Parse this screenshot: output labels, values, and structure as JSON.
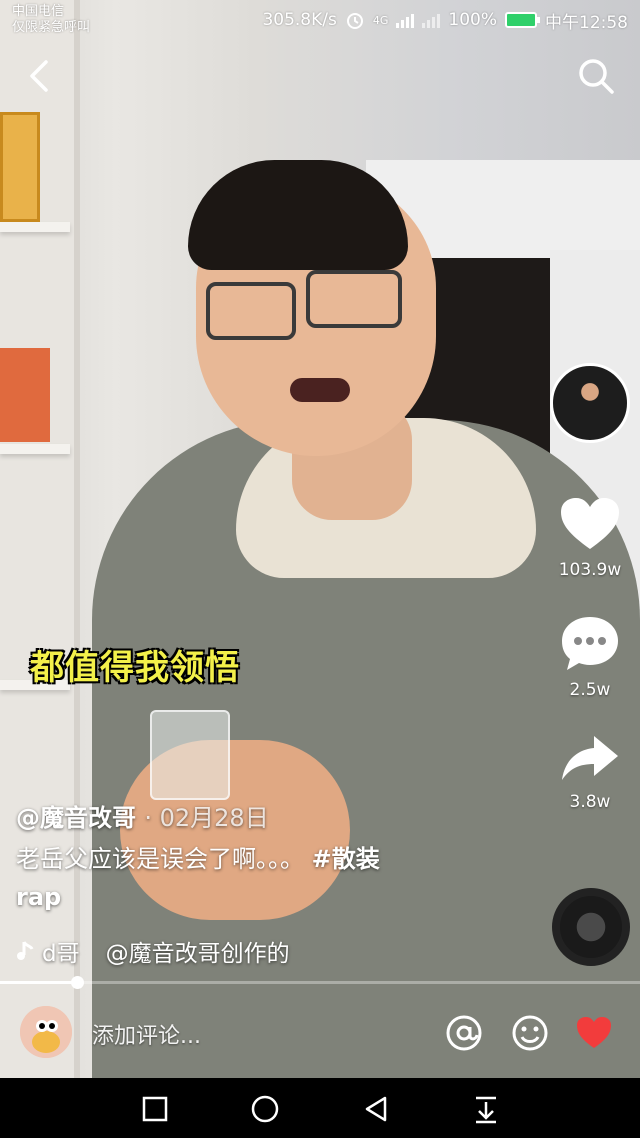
{
  "status_bar": {
    "carrier": "中国电信",
    "carrier_note": "仅限紧急呼叫",
    "speed": "305.8K/s",
    "network": "4G",
    "battery": "100%",
    "time": "中午12:58"
  },
  "icons": {
    "back": "back-arrow-icon",
    "search": "search-icon",
    "like": "heart-icon",
    "comment": "comment-icon",
    "share": "share-icon",
    "mention": "at-icon",
    "emoji": "emoji-icon",
    "heart_button": "heart-icon"
  },
  "colors": {
    "subtitle": "#f3f04a",
    "heart_active": "#f23c3c",
    "battery": "#2fd06a"
  },
  "subtitle": "都值得我领悟",
  "rail": {
    "likes": "103.9w",
    "comments": "2.5w",
    "shares": "3.8w"
  },
  "post": {
    "author": "@魔音改哥",
    "date": "02月28日",
    "description": "老岳父应该是误会了啊。。。",
    "hashtag_line1": "#散装",
    "hashtag_line2": "rap",
    "music_artist": "d哥",
    "music_title": "@魔音改哥创作的"
  },
  "playback": {
    "progress": 0.12
  },
  "comment_bar": {
    "placeholder": "添加评论..."
  }
}
